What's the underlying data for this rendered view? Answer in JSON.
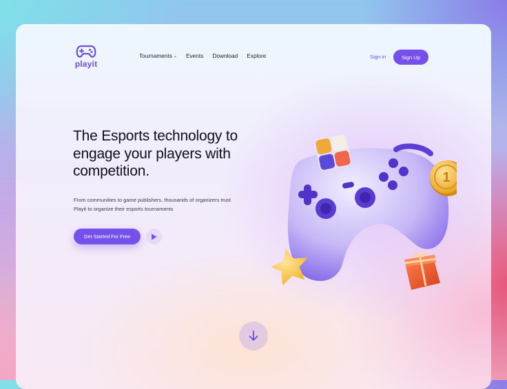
{
  "brand": {
    "name": "playit",
    "logo_icon": "gamepad-icon",
    "accent": "#7650ea"
  },
  "nav": {
    "items": [
      {
        "label": "Tournaments",
        "has_dropdown": true
      },
      {
        "label": "Events"
      },
      {
        "label": "Download"
      },
      {
        "label": "Explore"
      }
    ]
  },
  "auth": {
    "signin_label": "Sign in",
    "signup_label": "Sign Up"
  },
  "hero": {
    "headline": "The Esports technology to engage your players with competition.",
    "subtext": "From communities to game publishers, thousands of organizers trust Playit to organize their esports tournaments",
    "cta_label": "Get Started For Free",
    "play_icon": "play-icon"
  },
  "illustration": {
    "coin_label": "1",
    "elements": [
      "gamepad-illustration",
      "cube-icon",
      "coin-icon",
      "star-icon",
      "gift-box-icon"
    ]
  },
  "scroll": {
    "icon": "arrow-down-icon"
  }
}
